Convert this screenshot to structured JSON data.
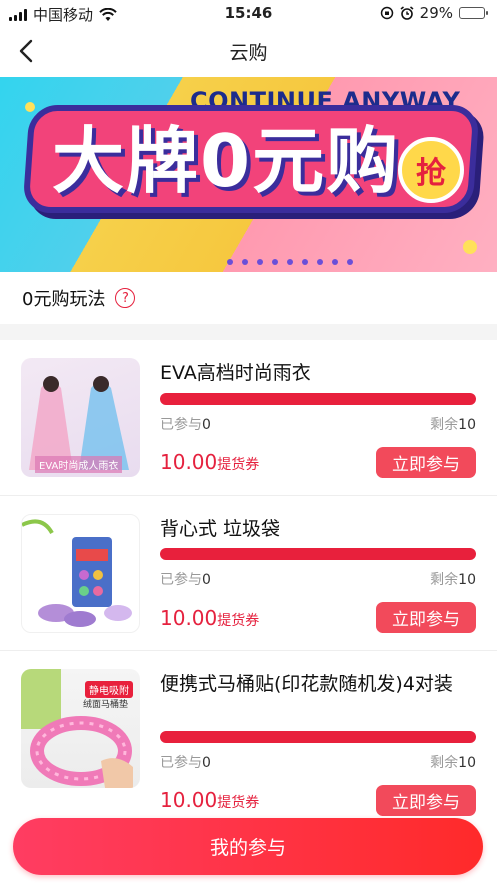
{
  "status_bar": {
    "carrier": "中国移动",
    "time": "15:46",
    "battery_percent": "29%",
    "battery_level": 0.29
  },
  "nav": {
    "title": "云购",
    "back_icon": "chevron-left-icon"
  },
  "banner": {
    "headline_en": "CONTINUE ANYWAY",
    "headline_cn": "大牌0元购",
    "badge": "抢"
  },
  "howto": {
    "label": "0元购玩法",
    "help_symbol": "?"
  },
  "items": [
    {
      "title": "EVA高档时尚雨衣",
      "image_caption": "EVA时尚成人雨衣",
      "joined_label": "已参与",
      "joined": "0",
      "remain_label": "剩余",
      "remain": "10",
      "progress": 0,
      "price": "10.00",
      "price_unit": "提货券",
      "button": "立即参与"
    },
    {
      "title": "背心式 垃圾袋",
      "image_caption": "",
      "joined_label": "已参与",
      "joined": "0",
      "remain_label": "剩余",
      "remain": "10",
      "progress": 0,
      "price": "10.00",
      "price_unit": "提货券",
      "button": "立即参与"
    },
    {
      "title": "便携式马桶贴(印花款随机发)4对装",
      "image_caption": "静电吸附",
      "image_caption2": "绒面马桶垫",
      "joined_label": "已参与",
      "joined": "0",
      "remain_label": "剩余",
      "remain": "10",
      "progress": 0,
      "price": "10.00",
      "price_unit": "提货券",
      "button": "立即参与"
    }
  ],
  "bottom_button": "我的参与",
  "colors": {
    "accent": "#e5213e",
    "progress": "#e8203c",
    "button": "#f24a5b"
  }
}
